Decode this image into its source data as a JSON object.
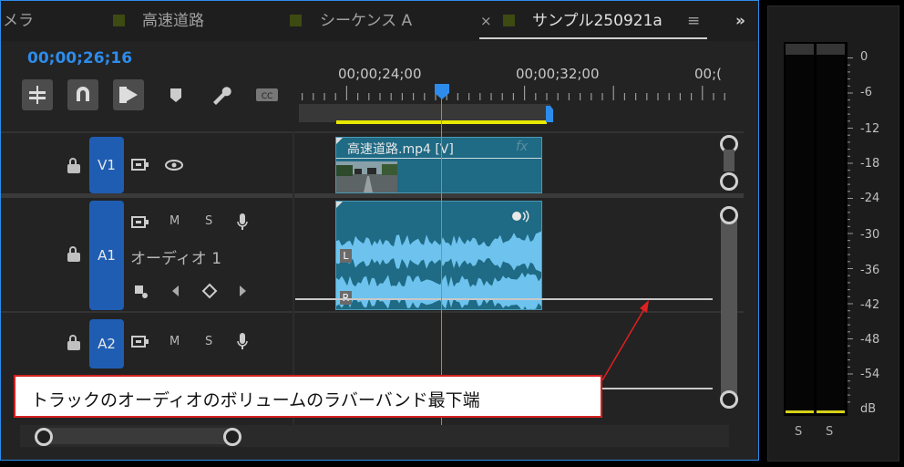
{
  "tabs": [
    {
      "label": "メラ"
    },
    {
      "label": "高速道路"
    },
    {
      "label": "シーケンス A"
    },
    {
      "label": "サンプル250921a",
      "active": true,
      "close": "×",
      "menu": "≡"
    }
  ],
  "tabs_overflow": "»",
  "timecode": "00;00;26;16",
  "ruler_labels": [
    "00;00;24;00",
    "00;00;32;00",
    "00;("
  ],
  "tracks": {
    "v1": {
      "name": "V1"
    },
    "a1": {
      "name": "A1",
      "title": "オーディオ 1",
      "m": "M",
      "s": "S"
    },
    "a2": {
      "name": "A2",
      "m": "M",
      "s": "S"
    }
  },
  "clips": {
    "video": {
      "name": "高速道路.mp4 [V]",
      "fx": "fx"
    },
    "audio": {
      "left_label": "L",
      "right_label": "R"
    }
  },
  "meter": {
    "db_labels": [
      "0",
      "-6",
      "-12",
      "-18",
      "-24",
      "-30",
      "-36",
      "-42",
      "-48",
      "-54",
      "dB"
    ],
    "solo_labels": [
      "S",
      "S"
    ],
    "level_color": "#d6d21a"
  },
  "callout": {
    "text": "トラックのオーディオのボリュームのラバーバンド最下端"
  },
  "colors": {
    "accent": "#2d8ceb",
    "track_button": "#1f5db3",
    "clip": "#1f6a84",
    "callout_border": "#d42020"
  }
}
